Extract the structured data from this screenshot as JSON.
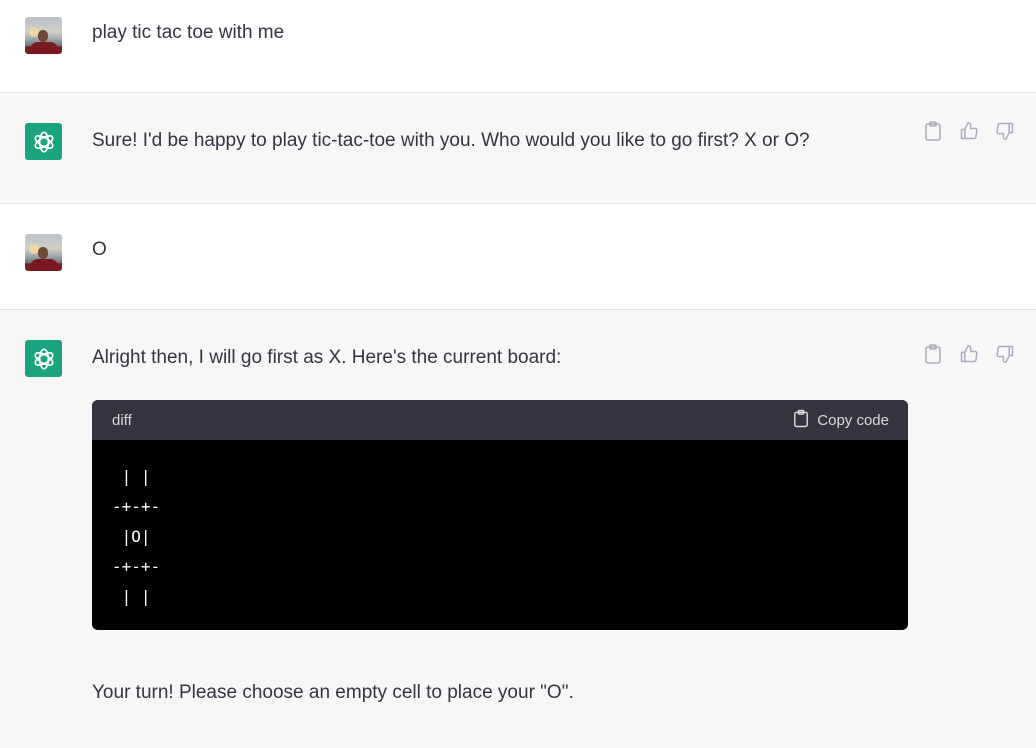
{
  "conversation": [
    {
      "role": "user",
      "text": "play tic tac toe with me"
    },
    {
      "role": "assistant",
      "text": "Sure! I'd be happy to play tic-tac-toe with you. Who would you like to go first? X or O?"
    },
    {
      "role": "user",
      "text": "O"
    },
    {
      "role": "assistant",
      "text": "Alright then, I will go first as X. Here's the current board:",
      "code": {
        "language": "diff",
        "copy_label": "Copy code",
        "lines": [
          " | |",
          "-+-+-",
          " |O|",
          "-+-+-",
          " | |"
        ]
      },
      "followup": "Your turn! Please choose an empty cell to place your \"O\"."
    }
  ],
  "icons": {
    "copy": "clipboard-icon",
    "like": "thumbs-up-icon",
    "dislike": "thumbs-down-icon",
    "assistant_logo": "openai-logo-icon"
  },
  "colors": {
    "assistant_avatar": "#19a37f",
    "code_header": "#343541",
    "code_background": "#000000",
    "text": "#343541"
  }
}
